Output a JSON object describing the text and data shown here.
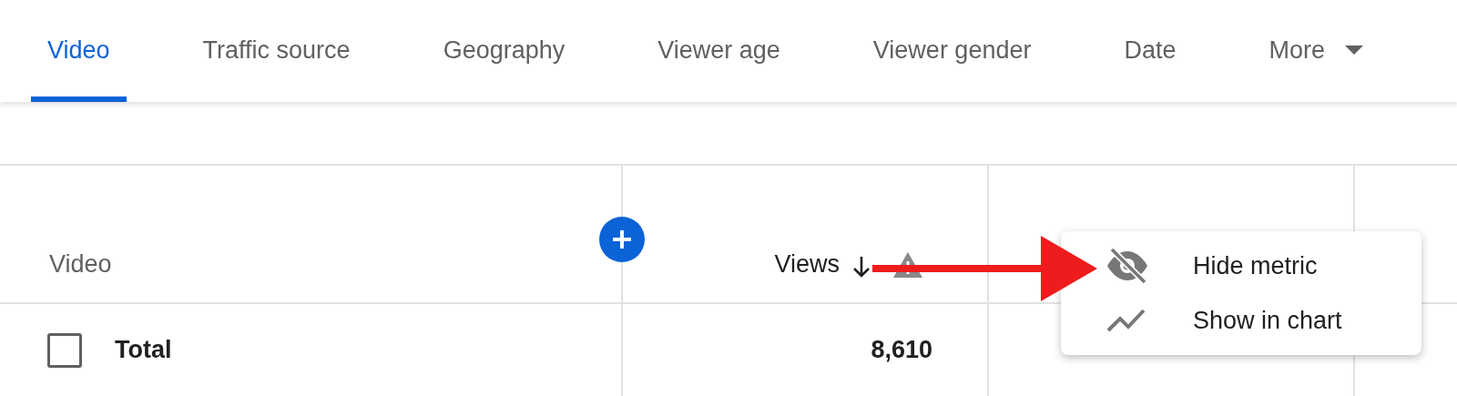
{
  "tabs": [
    {
      "label": "Video",
      "selected": true
    },
    {
      "label": "Traffic source",
      "selected": false
    },
    {
      "label": "Geography",
      "selected": false
    },
    {
      "label": "Viewer age",
      "selected": false
    },
    {
      "label": "Viewer gender",
      "selected": false
    },
    {
      "label": "Date",
      "selected": false
    },
    {
      "label": "More",
      "selected": false,
      "kind": "dropdown"
    }
  ],
  "table": {
    "columns": [
      {
        "label": "Video",
        "kind": "name"
      },
      {
        "label": "Views",
        "kind": "metric",
        "sorted": true,
        "warning": true
      }
    ],
    "rows": [
      {
        "checked": false,
        "cells": [
          "Total",
          "8,610"
        ]
      }
    ]
  },
  "context_menu": {
    "items": [
      {
        "label": "Hide metric"
      },
      {
        "label": "Show in chart"
      }
    ]
  }
}
